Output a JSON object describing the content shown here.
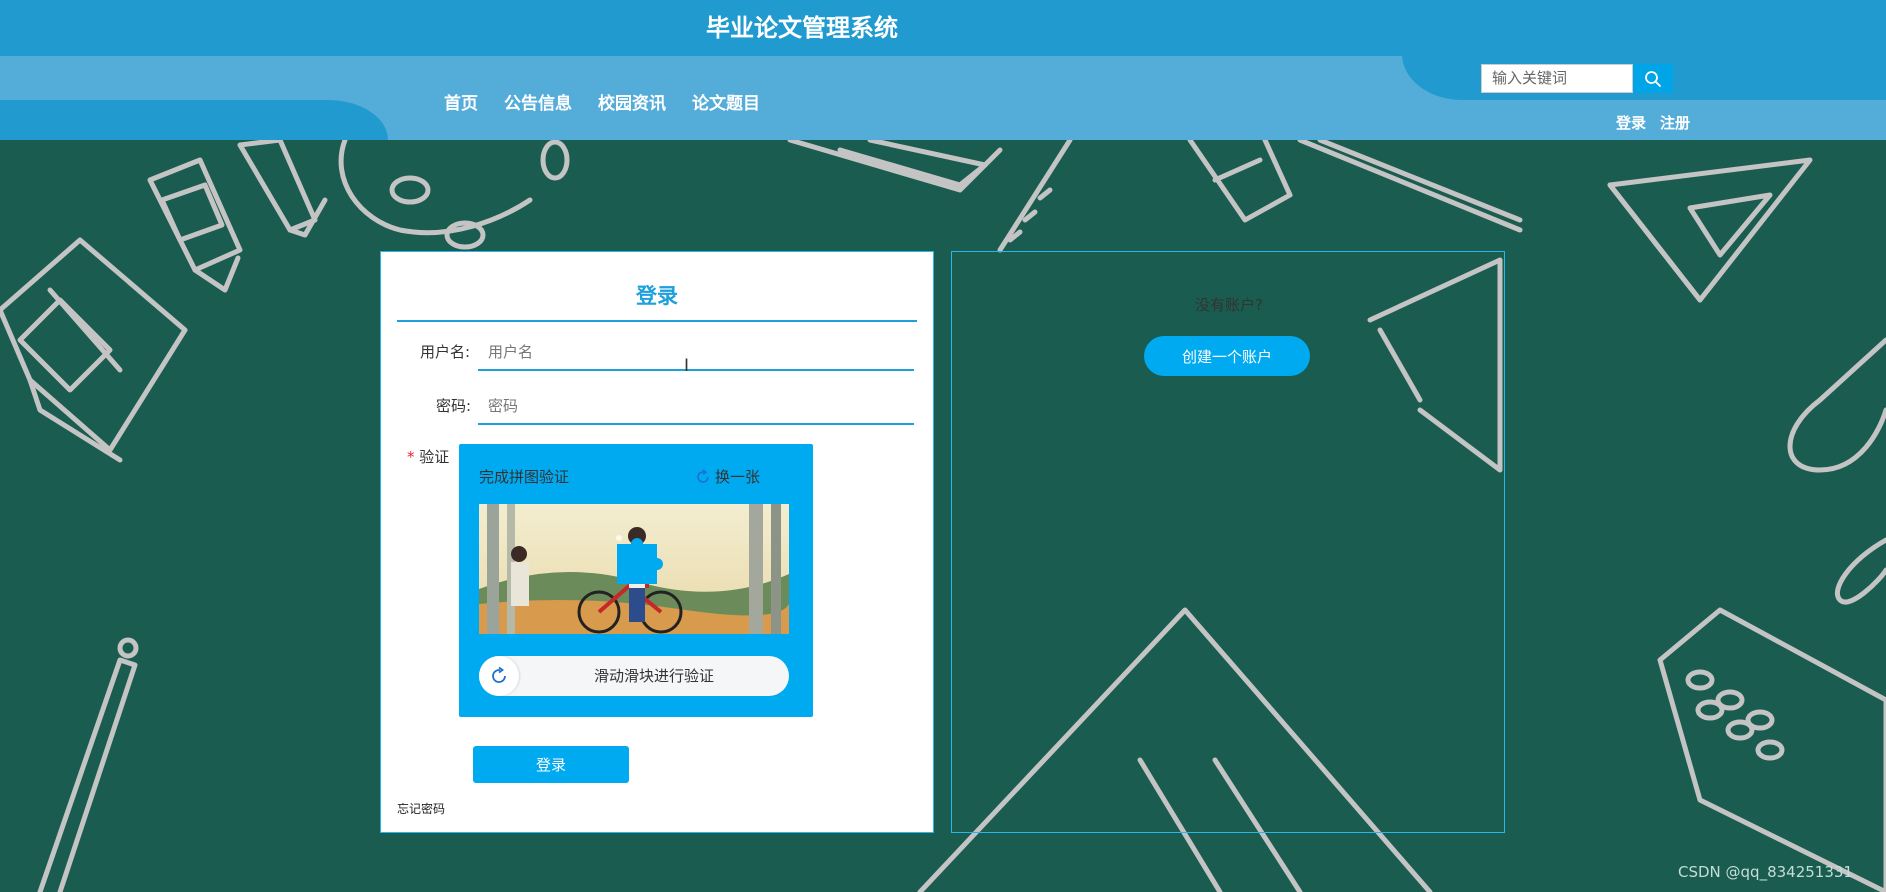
{
  "header": {
    "site_title": "毕业论文管理系统",
    "nav": [
      "首页",
      "公告信息",
      "校园资讯",
      "论文题目"
    ],
    "search_placeholder": "输入关键词",
    "login_link": "登录",
    "register_link": "注册"
  },
  "login": {
    "title": "登录",
    "username_label": "用户名:",
    "username_placeholder": "用户名",
    "password_label": "密码:",
    "password_placeholder": "密码",
    "verify_required": "*",
    "verify_label": "验证",
    "captcha_title": "完成拼图验证",
    "captcha_refresh": "换一张",
    "slider_text": "滑动滑块进行验证",
    "submit": "登录",
    "forgot": "忘记密码"
  },
  "register": {
    "question": "没有账户?",
    "button": "创建一个账户"
  },
  "watermark": "CSDN @qq_834251331",
  "colors": {
    "header_dark": "#219bcf",
    "header_light": "#54acd9",
    "accent": "#00aaf0",
    "background": "#1a5c50"
  }
}
